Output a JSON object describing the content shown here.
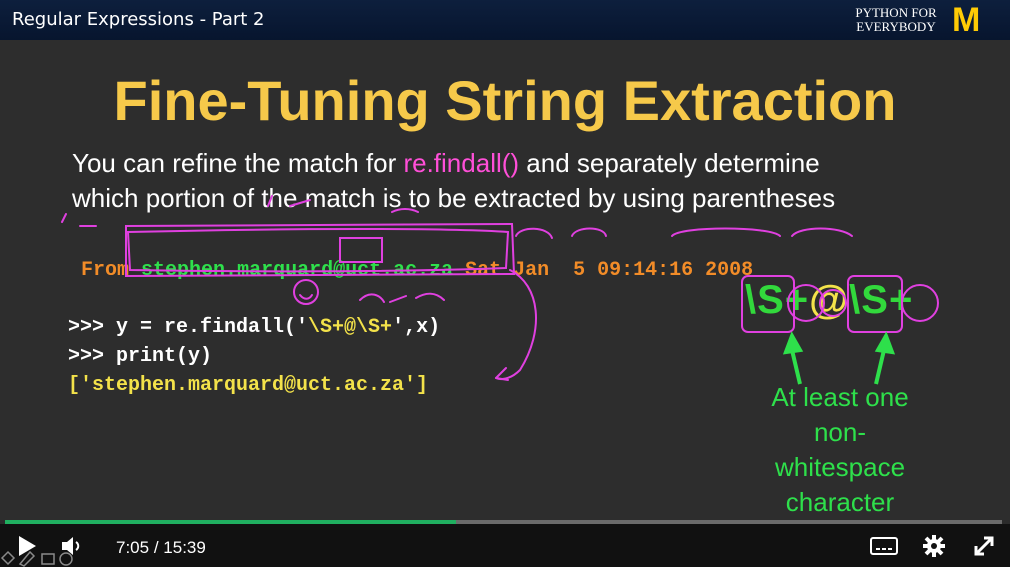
{
  "header": {
    "video_title": "Regular Expressions - Part 2",
    "brand_line1": "PYTHON FOR",
    "brand_line2": "EVERYBODY",
    "logo_letter": "M"
  },
  "slide": {
    "title": "Fine-Tuning String Extraction",
    "desc_line1_before": "You can refine the match for ",
    "desc_line1_highlight": "re.findall()",
    "desc_line1_after": " and separately determine",
    "desc_line2": "which portion of the match is to be extracted by using parentheses",
    "from_label": "From",
    "from_email": "stephen.marquard@uct.ac.za",
    "from_date": "Sat Jan  5 09:14:16 2008",
    "code_line1_prefix": ">>> y = re.findall('",
    "code_line1_regex": "\\S+@\\S+",
    "code_line1_suffix": "',x)",
    "code_line2": ">>> print(y)",
    "code_line3": "['stephen.marquard@uct.ac.za']",
    "big_regex_part1": "\\S+",
    "big_regex_at": "@",
    "big_regex_part2": "\\S+",
    "note_line1": "At least one",
    "note_line2": "non-",
    "note_line3": "whitespace",
    "note_line4": "character"
  },
  "player": {
    "current_time": "7:05",
    "separator": "/",
    "duration": "15:39",
    "progress_fraction": 0.4521
  },
  "colors": {
    "title": "#f6c94a",
    "highlight": "#ff4fd8",
    "green": "#2ee04b",
    "orange": "#f28c28",
    "progress": "#20b060"
  },
  "icons": [
    "play-icon",
    "volume-icon",
    "captions-icon",
    "gear-icon",
    "fullscreen-icon",
    "annotation-tools-icon"
  ]
}
